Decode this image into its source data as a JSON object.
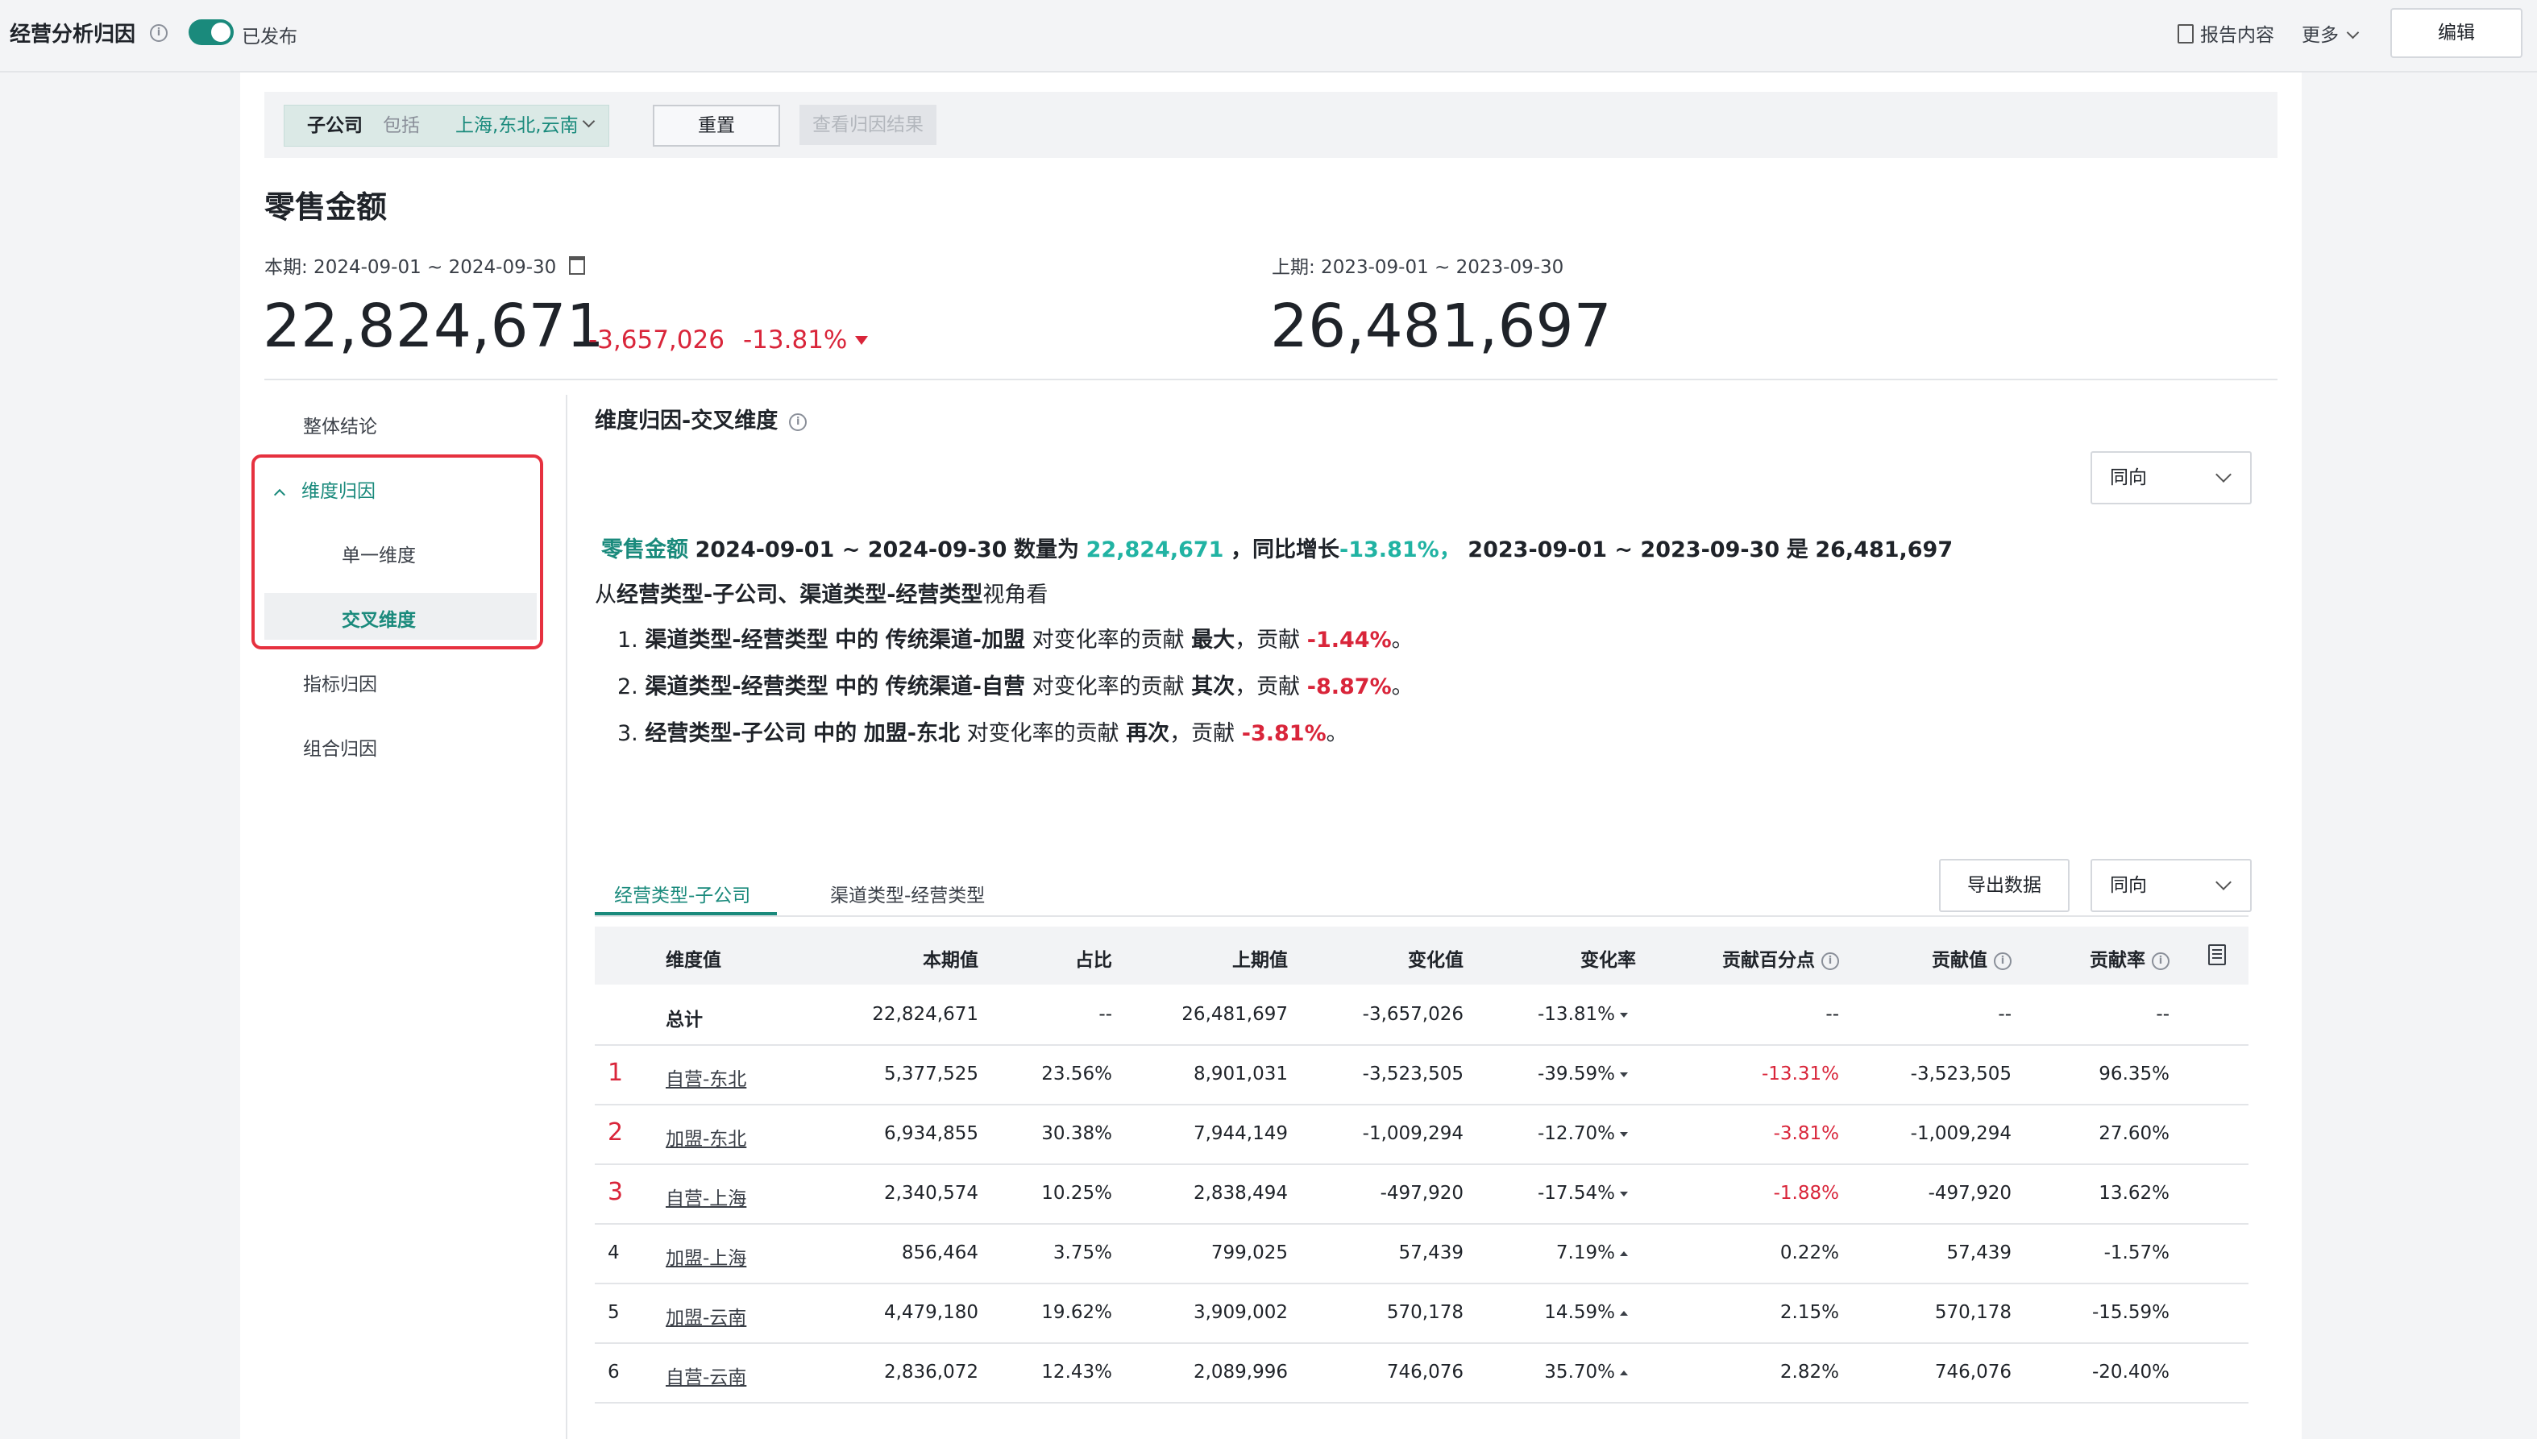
{
  "topbar": {
    "title": "经营分析归因",
    "title_info_icon": "info-icon",
    "publish_status": "已发布",
    "report_content": "报告内容",
    "more": "更多",
    "edit": "编辑"
  },
  "filter": {
    "dimension": "子公司",
    "include_label": "包括",
    "values": "上海,东北,云南",
    "reset": "重置",
    "view_result": "查看归因结果"
  },
  "metric": {
    "title": "零售金额",
    "current_period": "本期: 2024-09-01 ~ 2024-09-30",
    "current_value": "22,824,671",
    "delta_abs": "-3,657,026",
    "delta_pct": "-13.81%",
    "previous_period": "上期: 2023-09-01 ~ 2023-09-30",
    "previous_value": "26,481,697"
  },
  "sidebar": {
    "items": [
      {
        "label": "整体结论"
      },
      {
        "label": "维度归因"
      },
      {
        "label": "单一维度"
      },
      {
        "label": "交叉维度"
      },
      {
        "label": "指标归因"
      },
      {
        "label": "组合归因"
      }
    ]
  },
  "section": {
    "title": "维度归因-交叉维度",
    "direction_select": "同向"
  },
  "summary": {
    "metric": "零售金额",
    "period": "2024-09-01 ~ 2024-09-30",
    "qty_label": "数量为",
    "value": "22,824,671",
    "sep1": "，",
    "yoy_label": "同比增长",
    "yoy": "-13.81%",
    "sep2": "，",
    "prev_period": "2023-09-01 ~ 2023-09-30",
    "is_label": "是",
    "prev_value": "26,481,697",
    "perspective_prefix": "从",
    "perspective_dims": "经营类型-子公司、渠道类型-经营类型",
    "perspective_suffix": "视角看",
    "ranks": [
      {
        "no": "1.",
        "dim": "渠道类型-经营类型",
        "mid": "中的",
        "val": "传统渠道-加盟",
        "text": "对变化率的贡献",
        "level": "最大",
        "contrib_label": "，贡献",
        "contrib": "-1.44%",
        "end": "。"
      },
      {
        "no": "2.",
        "dim": "渠道类型-经营类型",
        "mid": "中的",
        "val": "传统渠道-自营",
        "text": "对变化率的贡献",
        "level": "其次",
        "contrib_label": "，贡献",
        "contrib": "-8.87%",
        "end": "。"
      },
      {
        "no": "3.",
        "dim": "经营类型-子公司",
        "mid": "中的",
        "val": "加盟-东北",
        "text": "对变化率的贡献",
        "level": "再次",
        "contrib_label": "，贡献",
        "contrib": "-3.81%",
        "end": "。"
      }
    ]
  },
  "tabs": [
    {
      "label": "经营类型-子公司"
    },
    {
      "label": "渠道类型-经营类型"
    }
  ],
  "table_tools": {
    "export": "导出数据",
    "direction_select": "同向"
  },
  "table": {
    "headers": [
      "维度值",
      "本期值",
      "占比",
      "上期值",
      "变化值",
      "变化率",
      "贡献百分点",
      "贡献值",
      "贡献率"
    ],
    "total": {
      "label": "总计",
      "cur": "22,824,671",
      "share": "--",
      "prev": "26,481,697",
      "delta": "-3,657,026",
      "rate": "-13.81%",
      "pp": "--",
      "contrib": "--",
      "crate": "--"
    },
    "rows": [
      {
        "rank": "1",
        "dim": "自营-东北",
        "cur": "5,377,525",
        "share": "23.56%",
        "prev": "8,901,031",
        "delta": "-3,523,505",
        "rate": "-39.59%",
        "dir": "down",
        "pp": "-13.31%",
        "contrib": "-3,523,505",
        "crate": "96.35%"
      },
      {
        "rank": "2",
        "dim": "加盟-东北",
        "cur": "6,934,855",
        "share": "30.38%",
        "prev": "7,944,149",
        "delta": "-1,009,294",
        "rate": "-12.70%",
        "dir": "down",
        "pp": "-3.81%",
        "contrib": "-1,009,294",
        "crate": "27.60%"
      },
      {
        "rank": "3",
        "dim": "自营-上海",
        "cur": "2,340,574",
        "share": "10.25%",
        "prev": "2,838,494",
        "delta": "-497,920",
        "rate": "-17.54%",
        "dir": "down",
        "pp": "-1.88%",
        "contrib": "-497,920",
        "crate": "13.62%"
      },
      {
        "rank": "4",
        "dim": "加盟-上海",
        "cur": "856,464",
        "share": "3.75%",
        "prev": "799,025",
        "delta": "57,439",
        "rate": "7.19%",
        "dir": "up",
        "pp": "0.22%",
        "contrib": "57,439",
        "crate": "-1.57%"
      },
      {
        "rank": "5",
        "dim": "加盟-云南",
        "cur": "4,479,180",
        "share": "19.62%",
        "prev": "3,909,002",
        "delta": "570,178",
        "rate": "14.59%",
        "dir": "up",
        "pp": "2.15%",
        "contrib": "570,178",
        "crate": "-15.59%"
      },
      {
        "rank": "6",
        "dim": "自营-云南",
        "cur": "2,836,072",
        "share": "12.43%",
        "prev": "2,089,996",
        "delta": "746,076",
        "rate": "35.70%",
        "dir": "up",
        "pp": "2.82%",
        "contrib": "746,076",
        "crate": "-20.40%"
      }
    ]
  },
  "colors": {
    "accent": "#1a8a7c",
    "accent_light": "#21b3a3",
    "negative": "#d9253a",
    "highlight_box": "#e6313f"
  }
}
